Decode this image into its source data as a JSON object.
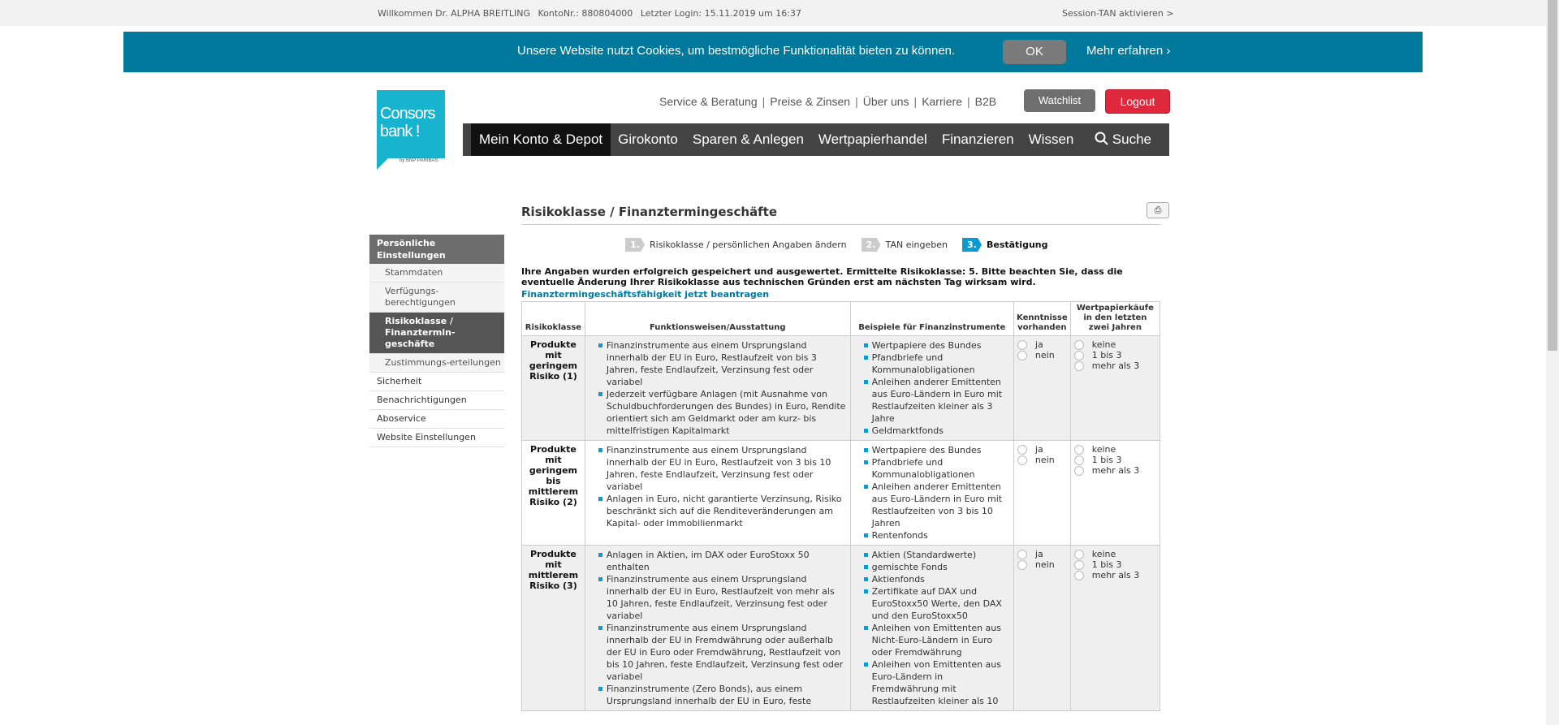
{
  "topbar": {
    "welcome": "Willkommen Dr. ALPHA BREITLING",
    "konto": "KontoNr.: 880804000",
    "login": "Letzter Login: 15.11.2019 um 16:37",
    "session": "Session-TAN aktivieren >"
  },
  "cookie": {
    "message": "Unsere Website nutzt Cookies, um bestmögliche Funktionalität bieten zu können.",
    "ok": "OK",
    "more": "Mehr erfahren"
  },
  "logo": {
    "line1": "Consors",
    "line2": "bank !",
    "by": "by BNP PARIBAS"
  },
  "servicenav": [
    "Service & Beratung",
    "Preise & Zinsen",
    "Über uns",
    "Karriere",
    "B2B"
  ],
  "buttons": {
    "watchlist": "Watchlist",
    "logout": "Logout"
  },
  "mainnav": [
    "Mein Konto & Depot",
    "Girokonto",
    "Sparen & Anlegen",
    "Wertpapierhandel",
    "Finanzieren",
    "Wissen"
  ],
  "search": "Suche",
  "sidebar": {
    "head": "Persönliche Einstellungen",
    "subs": [
      "Stammdaten",
      "Verfügungs-berechtigungen",
      "Risikoklasse / Finanztermin-geschäfte",
      "Zustimmungs-erteilungen"
    ],
    "tops": [
      "Sicherheit",
      "Benachrichtigungen",
      "Aboservice",
      "Website Einstellungen"
    ]
  },
  "title": "Risikoklasse / Finanztermingeschäfte",
  "steps": [
    {
      "num": "1.",
      "label": "Risikoklasse / persönlichen Angaben ändern"
    },
    {
      "num": "2.",
      "label": "TAN eingeben"
    },
    {
      "num": "3.",
      "label": "Bestätigung"
    }
  ],
  "notice": "Ihre Angaben wurden erfolgreich gespeichert und ausgewertet. Ermittelte Risikoklasse: 5. Bitte beachten Sie, dass die eventuelle Änderung Ihrer Risikoklasse aus technischen Gründen erst am nächsten Tag wirksam wird.",
  "link": "Finanztermingeschäftsfähigkeit jetzt beantragen",
  "table": {
    "headers": [
      "Risikoklasse",
      "Funktionsweisen/Ausstattung",
      "Beispiele für Finanzinstrumente",
      "Kenntnisse vorhanden",
      "Wertpapierkäufe in den letzten zwei Jahren"
    ],
    "knowledge": [
      "ja",
      "nein"
    ],
    "purchases": [
      "keine",
      "1 bis 3",
      "mehr als 3"
    ],
    "rows": [
      {
        "class": "Produkte mit geringem Risiko (1)",
        "features": [
          "Finanzinstrumente aus einem Ursprungsland innerhalb der EU in Euro, Restlaufzeit von bis 3 Jahren, feste Endlaufzeit, Verzinsung fest oder variabel",
          "Jederzeit verfügbare Anlagen (mit Ausnahme von Schuldbuchforderungen des Bundes) in Euro, Rendite orientiert sich am Geldmarkt oder am kurz- bis mittelfristigen Kapitalmarkt"
        ],
        "examples": [
          "Wertpapiere des Bundes",
          "Pfandbriefe und Kommunalobligationen",
          "Anleihen anderer Emittenten aus Euro-Ländern in Euro mit Restlaufzeiten kleiner als 3 Jahre",
          "Geldmarktfonds"
        ]
      },
      {
        "class": "Produkte mit geringem bis mittlerem Risiko (2)",
        "features": [
          "Finanzinstrumente aus einem Ursprungsland innerhalb der EU in Euro, Restlaufzeit von 3 bis 10 Jahren, feste Endlaufzeit, Verzinsung fest oder variabel",
          "Anlagen in Euro, nicht garantierte Verzinsung, Risiko beschränkt sich auf die Renditeveränderungen am Kapital- oder Immobilienmarkt"
        ],
        "examples": [
          "Wertpapiere des Bundes",
          "Pfandbriefe und Kommunalobligationen",
          "Anleihen anderer Emittenten aus Euro-Ländern in Euro mit Restlaufzeiten von 3 bis 10 Jahren",
          "Rentenfonds"
        ]
      },
      {
        "class": "Produkte mit mittlerem Risiko (3)",
        "features": [
          "Anlagen in Aktien, im DAX oder EuroStoxx 50 enthalten",
          "Finanzinstrumente aus einem Ursprungsland innerhalb der EU in Euro, Restlaufzeit von mehr als 10 Jahren, feste Endlaufzeit, Verzinsung fest oder variabel",
          "Finanzinstrumente aus einem Ursprungsland innerhalb der EU in Fremdwährung oder außerhalb der EU in Euro oder Fremdwährung, Restlaufzeit von bis 10 Jahren, feste Endlaufzeit, Verzinsung fest oder variabel",
          "Finanzinstrumente (Zero Bonds), aus einem Ursprungsland innerhalb der EU in Euro, feste"
        ],
        "examples": [
          "Aktien (Standardwerte)",
          "gemischte Fonds",
          "Aktienfonds",
          "Zertifikate auf DAX und EuroStoxx50 Werte, den DAX und den EuroStoxx50",
          "Anleihen von Emittenten aus Nicht-Euro-Ländern in Euro oder Fremdwährung",
          "Anleihen von Emittenten aus Euro-Ländern in Fremdwährung mit Restlaufzeiten kleiner als 10"
        ]
      }
    ]
  }
}
